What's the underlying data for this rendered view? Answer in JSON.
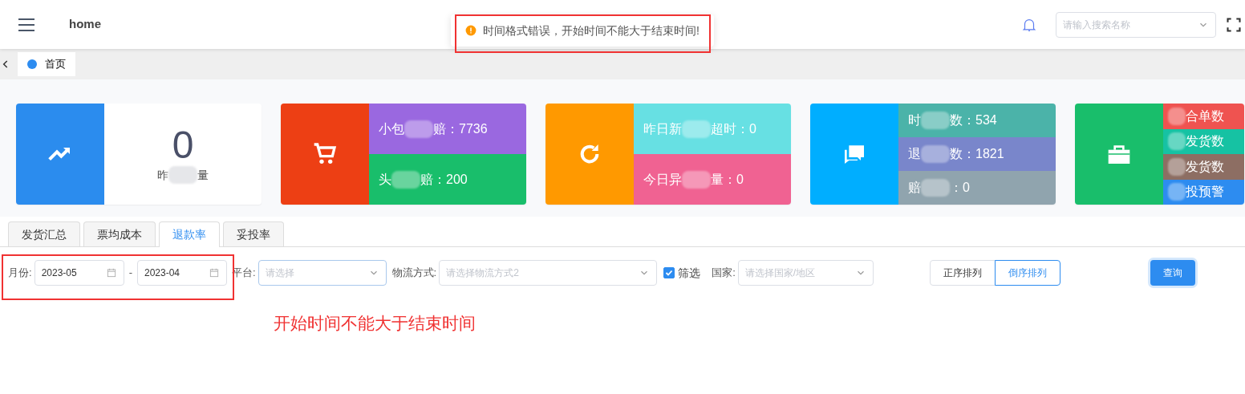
{
  "header": {
    "title": "home",
    "search_placeholder": "请输入搜索名称"
  },
  "toast": {
    "message": "时间格式错误，开始时间不能大于结束时间!"
  },
  "tags": [
    {
      "label": "首页",
      "selected": true
    }
  ],
  "cards": [
    {
      "kind": "single",
      "color": "#2b8cee",
      "value": "0",
      "text_start": "昨",
      "text_end": "量"
    },
    {
      "kind": "split",
      "color": "#ed3f14",
      "rows": [
        {
          "color": "#9a68e0",
          "text_start": "小包",
          "text_end": "赔：7736"
        },
        {
          "color": "#19be6b",
          "text_start": "头",
          "text_end": "赔：200"
        }
      ]
    },
    {
      "kind": "split",
      "color": "#ff9900",
      "rows": [
        {
          "color": "#67e0e3",
          "text_start": "昨日新",
          "text_end": "超时：0"
        },
        {
          "color": "#f06292",
          "text_start": "今日异",
          "text_end": "量：0"
        }
      ]
    },
    {
      "kind": "split",
      "color": "#00aeff",
      "rows": [
        {
          "color": "#4bb3a9",
          "text_start": "时",
          "text_end": "数：534"
        },
        {
          "color": "#7986cb",
          "text_start": "退",
          "text_end": "数：1821"
        },
        {
          "color": "#90a4ae",
          "text_start": "赔",
          "text_end": "：0"
        }
      ]
    },
    {
      "kind": "split",
      "color": "#19be6b",
      "rows": [
        {
          "color": "#ef5350",
          "text_end": "合单数"
        },
        {
          "color": "#16c2a3",
          "text_end": "发货数"
        },
        {
          "color": "#8d6e63",
          "text_end": "发货数"
        },
        {
          "color": "#2d8cf0",
          "text_end": "投预警"
        }
      ]
    }
  ],
  "tabs": [
    {
      "label": "发货汇总",
      "selected": false
    },
    {
      "label": "票均成本",
      "selected": false
    },
    {
      "label": "退款率",
      "selected": true
    },
    {
      "label": "妥投率",
      "selected": false
    }
  ],
  "filters": {
    "month_label": "月份:",
    "start": "2023-05",
    "separator": "-",
    "end": "2023-04",
    "platform_label": "平台:",
    "platform_placeholder": "请选择",
    "logistics_label": "物流方式:",
    "logistics_placeholder": "请选择物流方式2",
    "filter_check": {
      "label": "筛选",
      "checked": true
    },
    "country_label": "国家:",
    "country_placeholder": "请选择国家/地区",
    "sort": [
      {
        "label": "正序排列",
        "selected": false
      },
      {
        "label": "倒序排列",
        "selected": true
      }
    ],
    "query": "查询"
  },
  "error_message": "开始时间不能大于结束时间"
}
